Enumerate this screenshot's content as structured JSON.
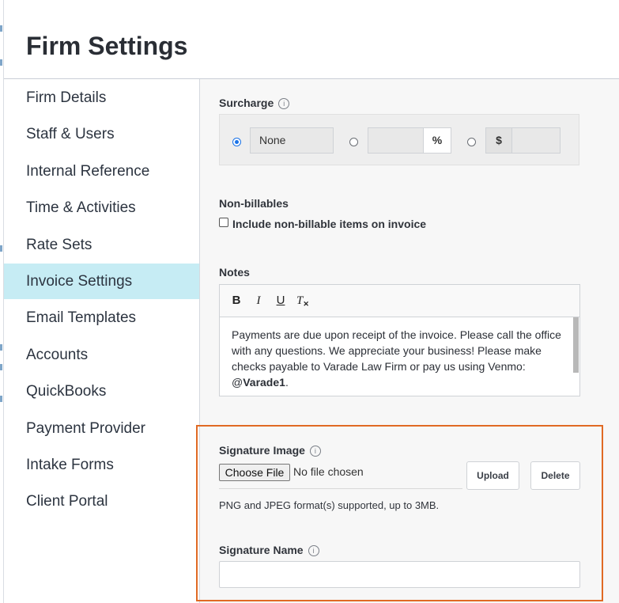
{
  "header": {
    "title": "Firm Settings"
  },
  "sidebar": {
    "items": [
      {
        "label": "Firm Details"
      },
      {
        "label": "Staff & Users"
      },
      {
        "label": "Internal Reference"
      },
      {
        "label": "Time & Activities"
      },
      {
        "label": "Rate Sets"
      },
      {
        "label": "Invoice Settings"
      },
      {
        "label": "Email Templates"
      },
      {
        "label": "Accounts"
      },
      {
        "label": "QuickBooks"
      },
      {
        "label": "Payment Provider"
      },
      {
        "label": "Intake Forms"
      },
      {
        "label": "Client Portal"
      }
    ],
    "active": "Invoice Settings"
  },
  "surcharge": {
    "label": "Surcharge",
    "selected_option": "none",
    "none_value": "None",
    "percent_value": "",
    "percent_symbol": "%",
    "dollar_symbol": "$",
    "dollar_value": ""
  },
  "non_billables": {
    "label": "Non-billables",
    "checkbox_label": "Include non-billable items on invoice",
    "checked": false
  },
  "notes": {
    "label": "Notes",
    "toolbar": {
      "bold": "B",
      "italic": "I",
      "underline": "U",
      "clear": "T"
    },
    "text_before": "Payments are due upon receipt of the invoice. Please call the office with any questions. We appreciate your business! Please make checks payable to Varade Law Firm or pay us using Venmo: @",
    "text_bold": "Varade1",
    "text_after": "."
  },
  "signature_image": {
    "label": "Signature Image",
    "choose_file": "Choose File",
    "file_status": "No file chosen",
    "upload": "Upload",
    "delete": "Delete",
    "help": "PNG and JPEG format(s) supported, up to 3MB."
  },
  "signature_name": {
    "label": "Signature Name",
    "value": ""
  },
  "colors": {
    "accent": "#c6ecf4",
    "highlight_border": "#e06a24",
    "radio": "#1a73e8"
  }
}
